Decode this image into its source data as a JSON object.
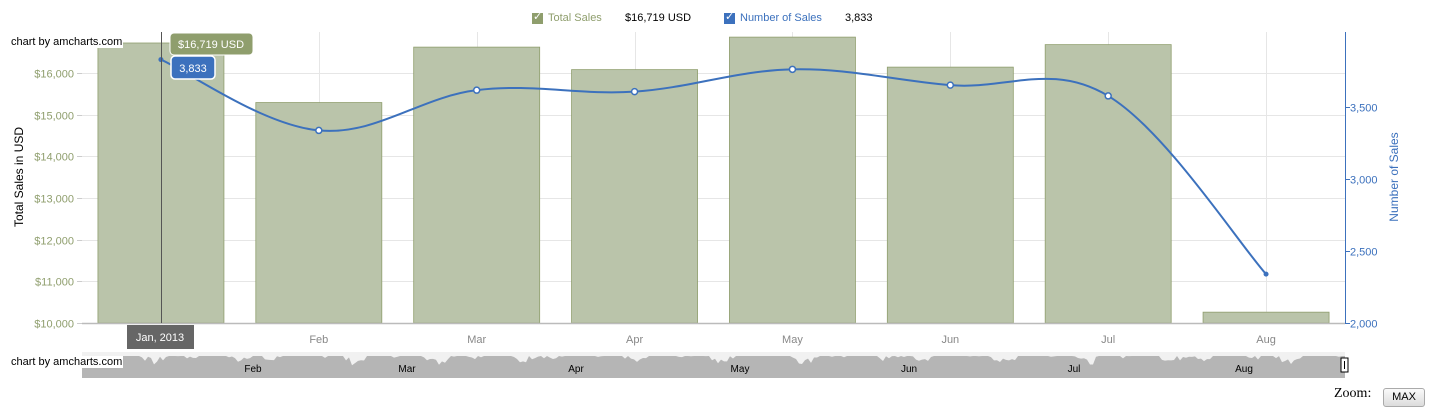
{
  "credit": "chart by amcharts.com",
  "legend": {
    "total_sales": {
      "label": "Total Sales",
      "value": "$16,719 USD",
      "color": "#8f9e6d"
    },
    "number_of_sales": {
      "label": "Number of Sales",
      "value": "3,833",
      "color": "#3c71bd"
    }
  },
  "zoom": {
    "label": "Zoom:",
    "button": "MAX"
  },
  "balloons": {
    "sales": "$16,719 USD",
    "count": "3,833",
    "cursor_category": "Jan, 2013"
  },
  "chart_data": {
    "type": "bar",
    "categories": [
      "Jan",
      "Feb",
      "Mar",
      "Apr",
      "May",
      "Jun",
      "Jul",
      "Aug"
    ],
    "series": [
      {
        "name": "Total Sales",
        "type": "bar",
        "axis": "left",
        "values": [
          16719,
          15290,
          16620,
          16080,
          16860,
          16140,
          16680,
          10260
        ],
        "color": "#b9c3a9"
      },
      {
        "name": "Number of Sales",
        "type": "line",
        "axis": "right",
        "values": [
          3833,
          3340,
          3620,
          3610,
          3765,
          3655,
          3580,
          2340
        ],
        "color": "#3c71bd"
      }
    ],
    "left_axis": {
      "label": "Total Sales in USD",
      "range": [
        10000,
        16719
      ],
      "ticks": [
        "$10,000",
        "$11,000",
        "$12,000",
        "$13,000",
        "$14,000",
        "$15,000",
        "$16,000"
      ]
    },
    "right_axis": {
      "label": "Number of Sales",
      "range": [
        2000,
        3990
      ],
      "ticks": [
        "2,000",
        "2,500",
        "3,000",
        "3,500"
      ]
    },
    "x_labels": [
      "Feb",
      "Mar",
      "Apr",
      "May",
      "Jun",
      "Jul",
      "Aug"
    ],
    "scrollbar_labels": [
      "Feb",
      "Mar",
      "Apr",
      "May",
      "Jun",
      "Jul",
      "Aug"
    ],
    "grid": true,
    "legend_position": "top"
  }
}
